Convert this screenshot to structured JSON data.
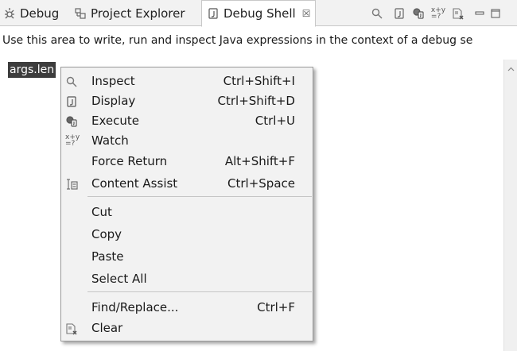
{
  "tabs": [
    {
      "label": "Debug",
      "icon": "debug-bug-icon"
    },
    {
      "label": "Project Explorer",
      "icon": "project-explorer-icon"
    },
    {
      "label": "Debug Shell",
      "icon": "debug-shell-icon",
      "active": true,
      "close": "☒"
    }
  ],
  "toolbar": [
    "inspect-icon",
    "display-icon",
    "execute-icon",
    "watch-icon",
    "clear-icon",
    "minimize-icon",
    "maximize-icon"
  ],
  "description": "Use this area to write, run and inspect Java expressions in the context of a debug se",
  "editor": {
    "text": "args.len"
  },
  "menu": {
    "group1": [
      {
        "label": "Inspect",
        "shortcut": "Ctrl+Shift+I",
        "icon": "inspect-icon"
      },
      {
        "label": "Display",
        "shortcut": "Ctrl+Shift+D",
        "icon": "display-icon"
      },
      {
        "label": "Execute",
        "shortcut": "Ctrl+U",
        "icon": "execute-icon"
      },
      {
        "label": "Watch",
        "shortcut": "",
        "icon": "watch-icon"
      },
      {
        "label": "Force Return",
        "shortcut": "Alt+Shift+F",
        "icon": ""
      },
      {
        "label": "Content Assist",
        "shortcut": "Ctrl+Space",
        "icon": "content-assist-icon"
      }
    ],
    "group2": [
      {
        "label": "Cut",
        "shortcut": ""
      },
      {
        "label": "Copy",
        "shortcut": ""
      },
      {
        "label": "Paste",
        "shortcut": ""
      },
      {
        "label": "Select All",
        "shortcut": ""
      }
    ],
    "group3": [
      {
        "label": "Find/Replace...",
        "shortcut": "Ctrl+F",
        "icon": ""
      },
      {
        "label": "Clear",
        "shortcut": "",
        "icon": "clear-icon"
      }
    ]
  }
}
